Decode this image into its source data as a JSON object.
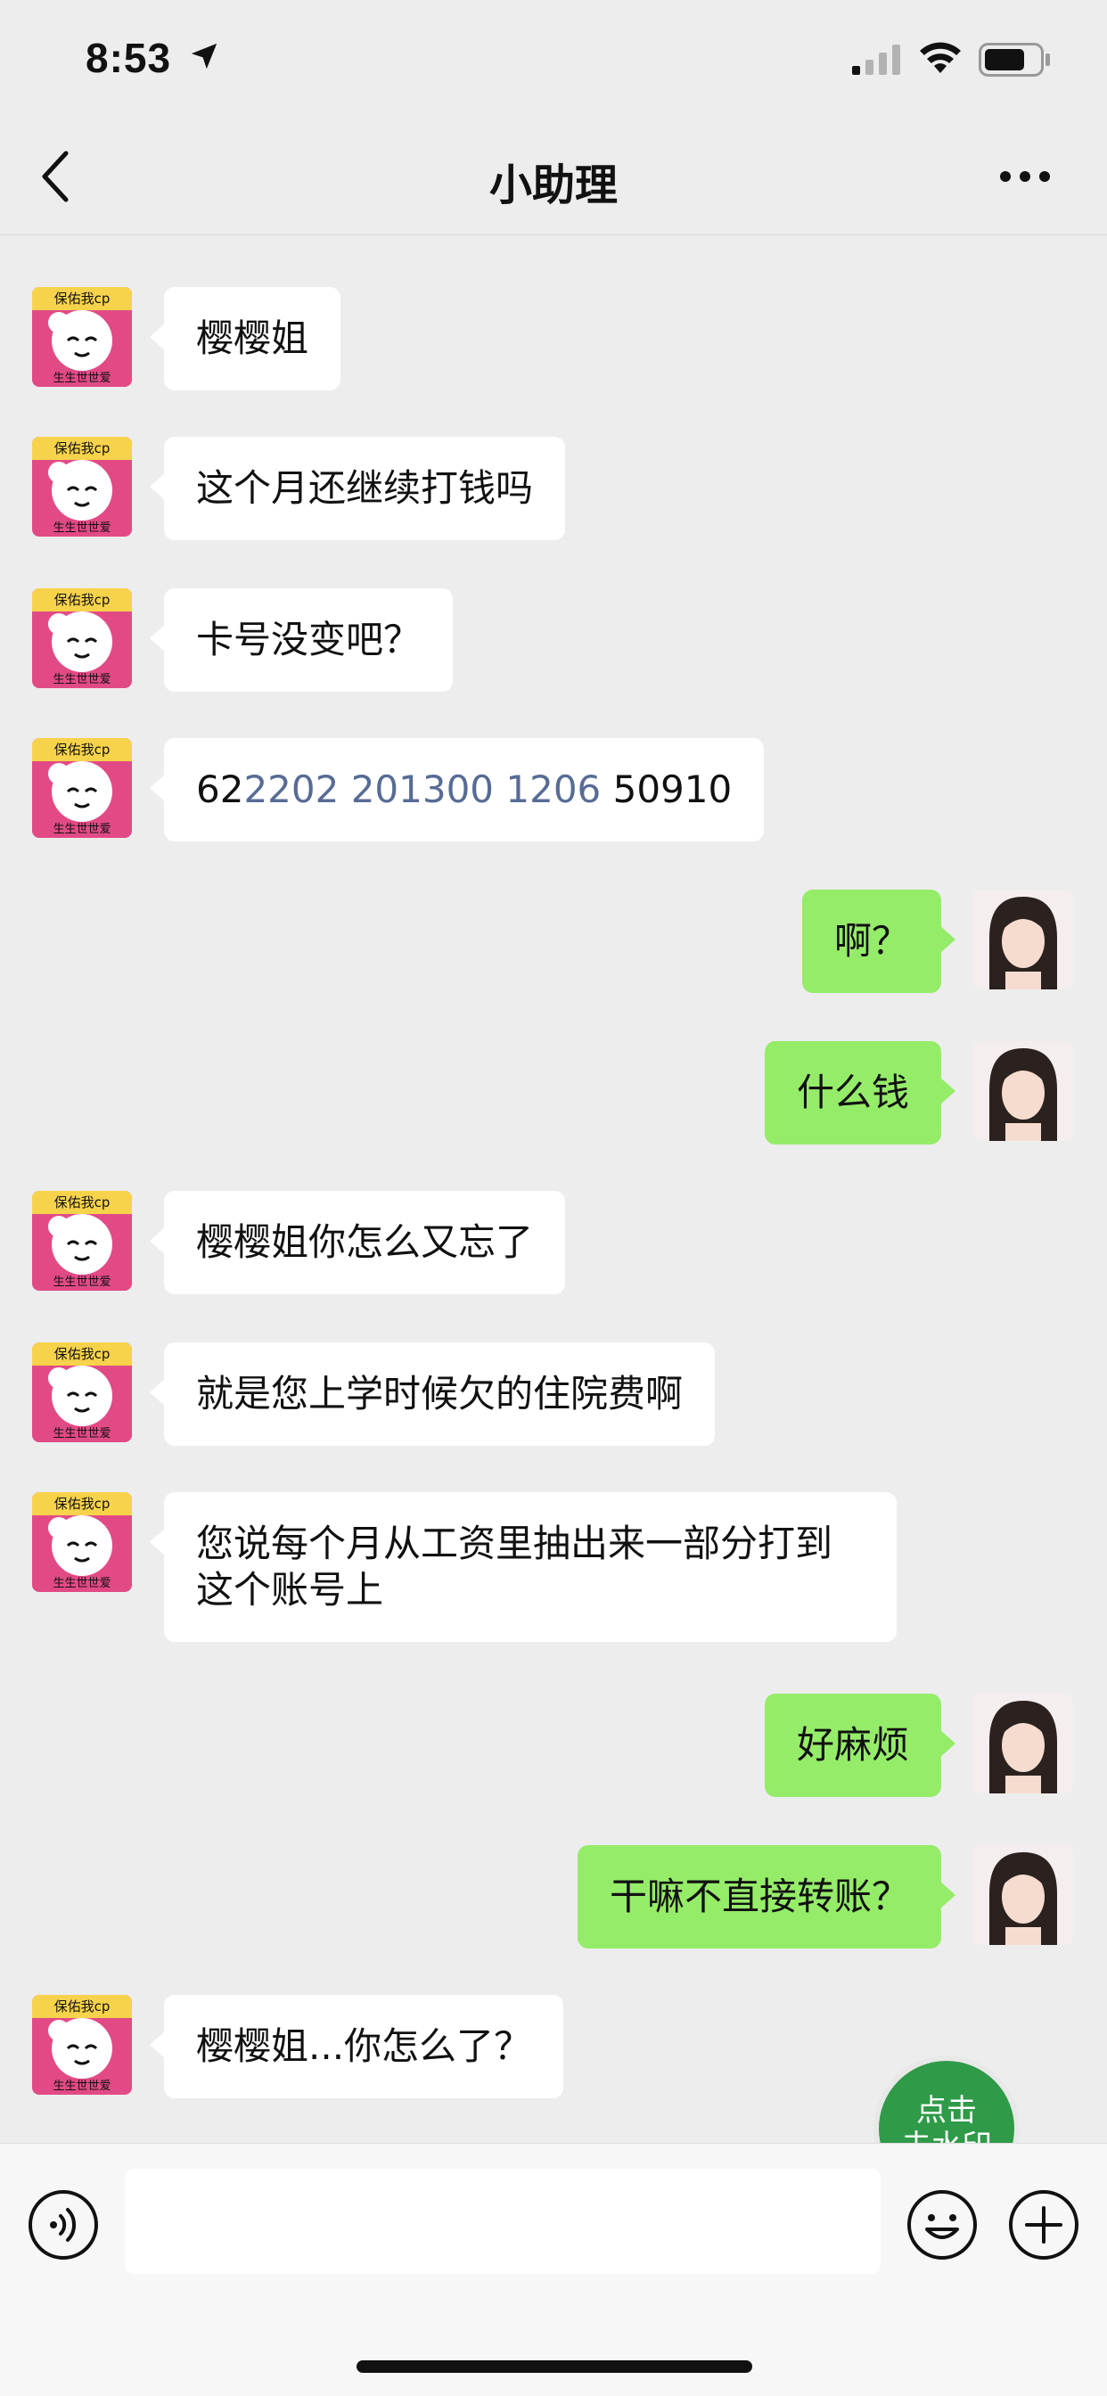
{
  "status_bar": {
    "time": "8:53"
  },
  "nav": {
    "title": "小助理"
  },
  "messages": [
    {
      "side": "left",
      "text": "樱樱姐"
    },
    {
      "side": "left",
      "text": "这个月还继续打钱吗"
    },
    {
      "side": "left",
      "text": "卡号没变吧？"
    },
    {
      "side": "left",
      "card_prefix": "62",
      "card_middle": "2202 201300 1206",
      "card_suffix": " 50910"
    },
    {
      "side": "right",
      "text": "啊？"
    },
    {
      "side": "right",
      "text": "什么钱"
    },
    {
      "side": "left",
      "text": "樱樱姐你怎么又忘了"
    },
    {
      "side": "left",
      "text": "就是您上学时候欠的住院费啊"
    },
    {
      "side": "left",
      "text": "您说每个月从工资里抽出来一部分打到这个账号上"
    },
    {
      "side": "right",
      "text": "好麻烦"
    },
    {
      "side": "right",
      "text": "干嘛不直接转账？"
    },
    {
      "side": "left",
      "text": "樱樱姐...你怎么了？"
    }
  ],
  "left_avatar": {
    "top_text": "保佑我cp",
    "bottom_text": "生生世世爱"
  },
  "watermark_badge": {
    "line1": "点击",
    "line2": "去水印"
  },
  "input": {
    "value": "",
    "placeholder": ""
  },
  "colors": {
    "background": "#ededed",
    "self_bubble": "#95ec69",
    "other_bubble": "#ffffff",
    "link": "#576b95"
  }
}
